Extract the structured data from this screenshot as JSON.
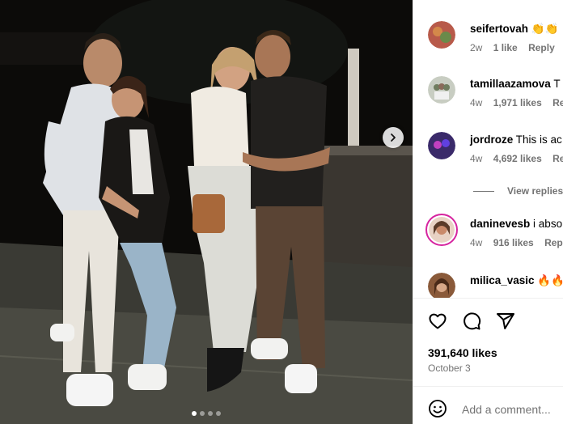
{
  "post": {
    "slide_count": 4,
    "active_slide": 1
  },
  "comments": [
    {
      "username": "seifertovah",
      "text": "👏👏",
      "age": "2w",
      "likes": "1 like",
      "reply": "Reply",
      "avatar_color": "#b85a4a"
    },
    {
      "username": "tamillaazamova",
      "text": "T",
      "age": "4w",
      "likes": "1,971 likes",
      "reply": "Rep",
      "avatar_color": "#6f7c5e"
    },
    {
      "username": "jordroze",
      "text": "This is ac",
      "age": "4w",
      "likes": "4,692 likes",
      "reply": "Re",
      "avatar_color": "#3a2a6a"
    },
    {
      "username": "daninevesb",
      "text": "i abso",
      "age": "4w",
      "likes": "916 likes",
      "reply": "Reply",
      "avatar_color": "#c98a6a"
    },
    {
      "username": "milica_vasic",
      "text": "🔥🔥",
      "avatar_color": "#8a5a3a"
    }
  ],
  "view_replies": "View replies",
  "likes_count": "391,640 likes",
  "date": "October 3",
  "comment_placeholder": "Add a comment...",
  "icons": [
    "heart-icon",
    "comment-icon",
    "share-icon",
    "emoji-icon",
    "chevron-right-icon"
  ],
  "colors": {
    "avatar_ring": "#d6249f",
    "muted_text": "#737373"
  }
}
